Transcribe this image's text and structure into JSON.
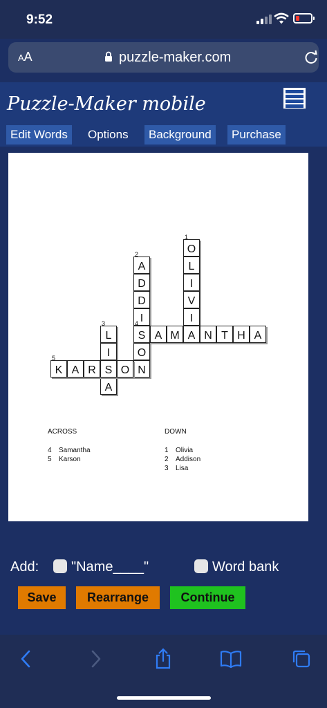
{
  "status": {
    "time": "9:52"
  },
  "browser": {
    "text_size": "AA",
    "url": "puzzle-maker.com"
  },
  "site": {
    "title": "Puzzle-Maker mobile",
    "tabs": [
      {
        "label": "Edit Words"
      },
      {
        "label": "Options"
      },
      {
        "label": "Background"
      },
      {
        "label": "Purchase"
      }
    ]
  },
  "puzzle": {
    "numbers": {
      "n1": "1",
      "n2": "2",
      "n3": "3",
      "n4": "4",
      "n5": "5"
    },
    "cells": {
      "olivia": [
        "O",
        "L",
        "I",
        "V",
        "I"
      ],
      "addison": [
        "A",
        "D",
        "D",
        "I",
        "S",
        "O",
        "N"
      ],
      "samantha": [
        "S",
        "A",
        "M",
        "A",
        "N",
        "T",
        "H",
        "A"
      ],
      "lisa": [
        "L",
        "I",
        "S",
        "A"
      ],
      "karson": [
        "K",
        "A",
        "R",
        "S",
        "O",
        "N"
      ]
    },
    "across_heading": "ACROSS",
    "down_heading": "DOWN",
    "across": [
      {
        "num": "4",
        "word": "Samantha"
      },
      {
        "num": "5",
        "word": "Karson"
      }
    ],
    "down": [
      {
        "num": "1",
        "word": "Olivia"
      },
      {
        "num": "2",
        "word": "Addison"
      },
      {
        "num": "3",
        "word": "Lisa"
      }
    ]
  },
  "controls": {
    "add_label": "Add:",
    "name_option": "\"Name____\"",
    "wordbank_option": "Word bank",
    "save": "Save",
    "rearrange": "Rearrange",
    "continue": "Continue"
  },
  "colors": {
    "save": "#e07a00",
    "rearrange": "#e07a00",
    "continue": "#1fc21f",
    "header": "#1e3a7a",
    "tab": "#2f5aa8"
  }
}
